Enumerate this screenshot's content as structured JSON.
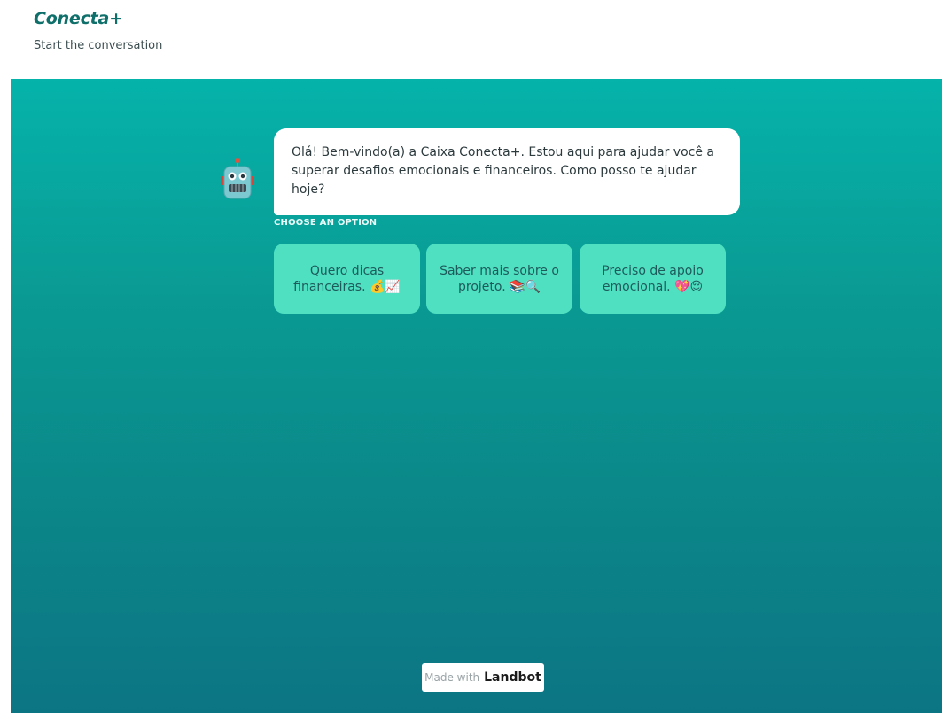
{
  "header": {
    "title": "Conecta+",
    "subtitle": "Start the conversation"
  },
  "bot": {
    "avatar_icon": "robot-icon",
    "message": "Olá! Bem-vindo(a) a Caixa Conecta+. Estou aqui para ajudar você a superar desafios emocionais e financeiros. Como posso te ajudar hoje?"
  },
  "options": {
    "label": "CHOOSE AN OPTION",
    "items": [
      {
        "label": "Quero dicas financeiras. 💰📈"
      },
      {
        "label": "Saber mais sobre o projeto. 📚🔍"
      },
      {
        "label": "Preciso de apoio emocional. 💖😌"
      }
    ]
  },
  "footer": {
    "made_with": "Made with",
    "brand": "Landbot"
  },
  "colors": {
    "chat_gradient_top": "#05b3aa",
    "chat_gradient_bottom": "#0c7584",
    "option_bg": "#4fe0c2",
    "title_color": "#0f6f6a"
  }
}
